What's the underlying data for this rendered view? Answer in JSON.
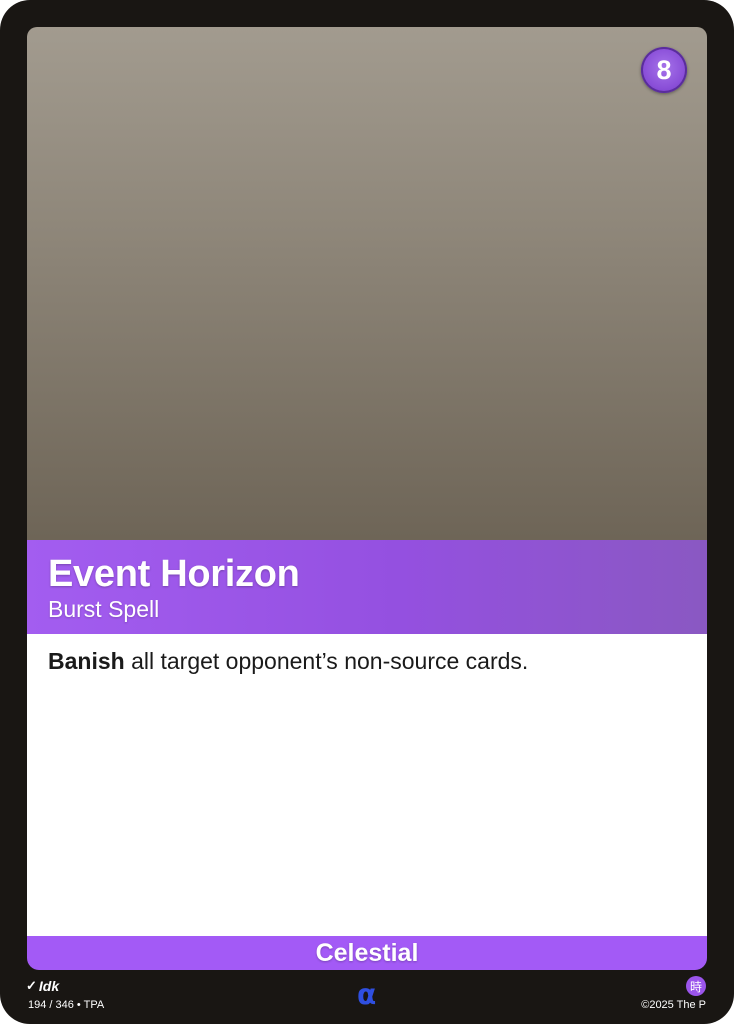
{
  "card": {
    "cost": "8",
    "name": "Event Horizon",
    "type_line": "Burst Spell",
    "rules_keyword": "Banish",
    "rules_text": " all target opponent’s non-source cards.",
    "faction": "Celestial",
    "artist": "Idk",
    "collector_line": "194 / 346 • TPA",
    "rarity_symbol": "α",
    "language_badge": "時",
    "copyright": "©2025 The P"
  },
  "colors": {
    "frame": "#191613",
    "accent_purple": "#a35af6",
    "rarity_blue": "#2f4fe0"
  },
  "icons": {
    "artist_icon": "pen-icon",
    "cost_icon": "cost-gem-icon"
  }
}
